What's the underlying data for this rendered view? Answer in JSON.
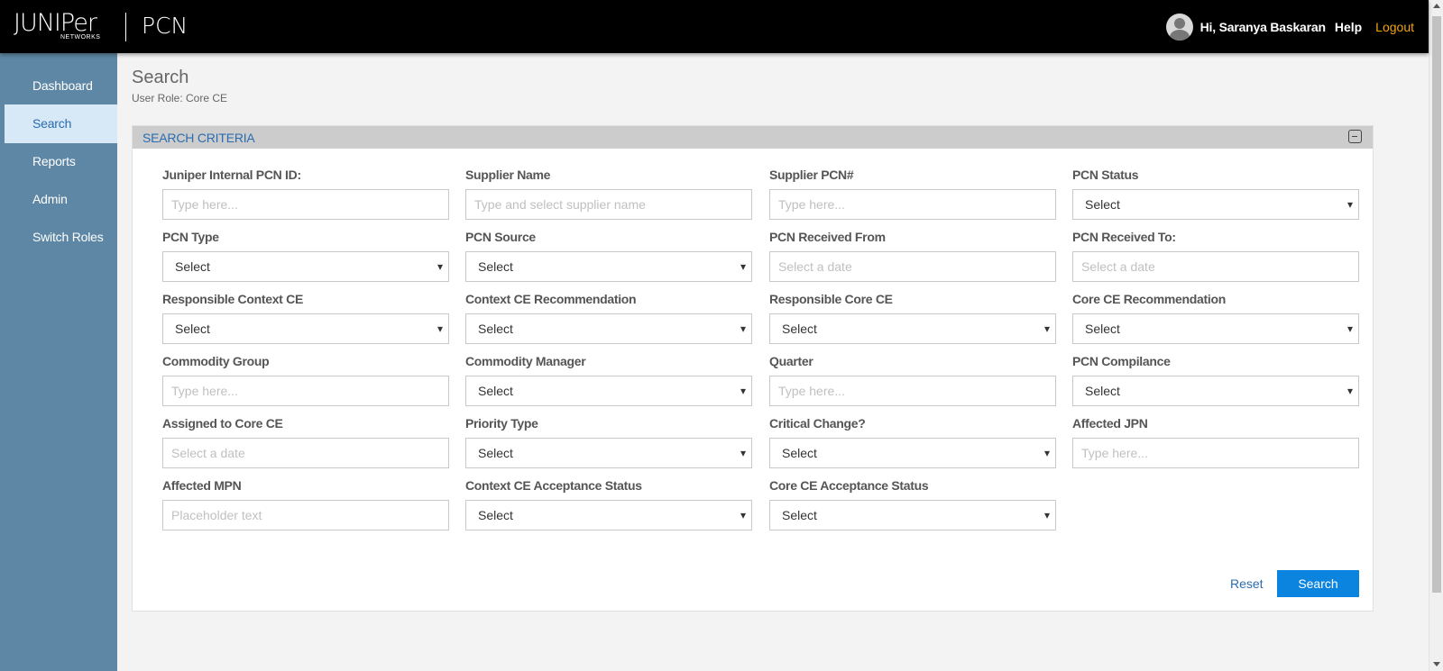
{
  "header": {
    "logo_word": "JUNIPer",
    "logo_sub": "NETWORKS",
    "app_title": "PCN",
    "greeting": "Hi, Saranya Baskaran",
    "help": "Help",
    "logout": "Logout"
  },
  "sidebar": {
    "items": [
      {
        "label": "Dashboard"
      },
      {
        "label": "Search"
      },
      {
        "label": "Reports"
      },
      {
        "label": "Admin"
      },
      {
        "label": "Switch Roles"
      }
    ],
    "active": "Search"
  },
  "page": {
    "title": "Search",
    "user_role": "User Role: Core CE"
  },
  "panel": {
    "title": "SEARCH CRITERIA"
  },
  "fields": [
    {
      "label": "Juniper Internal PCN ID:",
      "type": "text",
      "value": "Type here..."
    },
    {
      "label": "Supplier Name",
      "type": "text",
      "value": "Type and select supplier name"
    },
    {
      "label": "Supplier PCN#",
      "type": "text",
      "value": "Type here..."
    },
    {
      "label": "PCN Status",
      "type": "select",
      "value": "Select"
    },
    {
      "label": "PCN Type",
      "type": "select",
      "value": "Select"
    },
    {
      "label": "PCN Source",
      "type": "select",
      "value": "Select"
    },
    {
      "label": "PCN Received From",
      "type": "date",
      "value": "Select a date"
    },
    {
      "label": "PCN Received To:",
      "type": "date",
      "value": "Select a date"
    },
    {
      "label": "Responsible Context CE",
      "type": "select",
      "value": "Select"
    },
    {
      "label": "Context CE Recommendation",
      "type": "select",
      "value": "Select"
    },
    {
      "label": "Responsible Core CE",
      "type": "select",
      "value": "Select"
    },
    {
      "label": "Core CE Recommendation",
      "type": "select",
      "value": "Select"
    },
    {
      "label": "Commodity Group",
      "type": "text",
      "value": "Type here..."
    },
    {
      "label": "Commodity Manager",
      "type": "select",
      "value": "Select"
    },
    {
      "label": "Quarter",
      "type": "text",
      "value": "Type here..."
    },
    {
      "label": "PCN Compilance",
      "type": "select",
      "value": "Select"
    },
    {
      "label": "Assigned to Core CE",
      "type": "date",
      "value": "Select a date"
    },
    {
      "label": "Priority Type",
      "type": "select",
      "value": "Select"
    },
    {
      "label": "Critical Change?",
      "type": "select",
      "value": "Select"
    },
    {
      "label": "Affected JPN",
      "type": "text",
      "value": "Type here..."
    },
    {
      "label": "Affected MPN",
      "type": "text",
      "value": "Placeholder text"
    },
    {
      "label": "Context CE Acceptance Status",
      "type": "select",
      "value": "Select"
    },
    {
      "label": "Core CE Acceptance Status",
      "type": "select",
      "value": "Select"
    }
  ],
  "actions": {
    "reset": "Reset",
    "search": "Search"
  },
  "colors": {
    "header_bg": "#000000",
    "sidebar_bg": "#5d87a4",
    "active_nav_bg": "#d7e8f7",
    "accent_blue": "#2a6cb0",
    "search_button": "#0b84e0",
    "logout": "#f0a30a"
  }
}
